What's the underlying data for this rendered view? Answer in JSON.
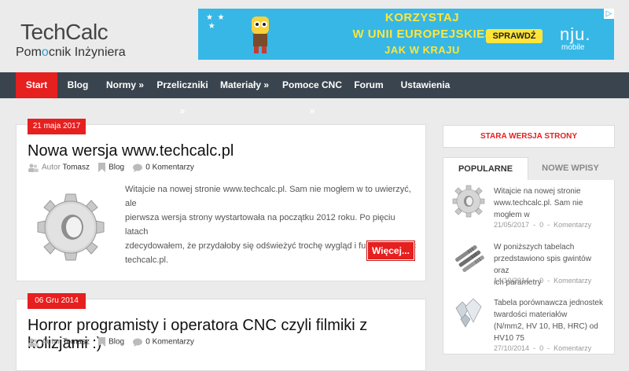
{
  "logo": {
    "title": "TechCalc",
    "subtitle_pre": "Pom",
    "subtitle_o": "o",
    "subtitle_post": "cnik Inżyniera"
  },
  "ad": {
    "line1": "KORZYSTAJ",
    "line2": "W UNII EUROPEJSKIEJ",
    "line3": "JAK W KRAJU",
    "cta": "SPRAWDŹ",
    "brand": "nju.",
    "brand_sub": "mobile",
    "adchoices": "▷"
  },
  "nav": {
    "items": [
      {
        "label": "Start"
      },
      {
        "label": "Blog"
      },
      {
        "label": "Normy »"
      },
      {
        "label": "Przeliczniki »"
      },
      {
        "label": "Materiały »"
      },
      {
        "label": "Pomoce CNC »"
      },
      {
        "label": "Forum"
      },
      {
        "label": "Ustawienia"
      }
    ]
  },
  "posts": [
    {
      "date": "21 maja 2017",
      "title": "Nowa wersja www.techcalc.pl",
      "author_label": "Autor",
      "author": "Tomasz",
      "category": "Blog",
      "comments": "0 Komentarzy",
      "excerpt_lines": [
        "Witajcie na nowej stronie www.techcalc.pl. Sam nie mogłem w to uwierzyć, ale",
        "pierwsza wersja strony wystartowała na początku 2012 roku. Po pięciu latach",
        "zdecydowałem, że przydałoby się odświeżyć trochę wygląd i funkcjonalność",
        "techcalc.pl."
      ],
      "more": "Więcej..."
    },
    {
      "date": "06 Gru 2014",
      "title": "Horror programisty i operatora CNC czyli filmiki z kolizjami :)",
      "author_label": "Autor",
      "author": "Tomasz",
      "category": "Blog",
      "comments": "0 Komentarzy"
    }
  ],
  "sidebar": {
    "old_version": "STARA WERSJA STRONY",
    "tab_popular": "POPULARNE WPISY",
    "tab_new": "NOWE WPISY",
    "items": [
      {
        "lines": [
          "Witajcie na nowej stronie",
          "www.techcalc.pl. Sam nie",
          "mogłem w"
        ],
        "date": "21/05/2017",
        "sep": "-",
        "comments": "0",
        "comments_label": "Komentarzy"
      },
      {
        "lines": [
          "W poniższych tabelach",
          "przedstawiono spis gwintów oraz",
          "ich parametry"
        ],
        "date": "14/10/2014",
        "sep": "-",
        "comments": "0",
        "comments_label": "Komentarzy"
      },
      {
        "lines": [
          "Tabela porównawcza jednostek",
          "twardości materiałów",
          "(N/mm2, HV 10, HB, HRC) od",
          "HV10 75"
        ],
        "date": "27/10/2014",
        "sep": "-",
        "comments": "0",
        "comments_label": "Komentarzy"
      }
    ]
  },
  "colors": {
    "accent": "#e61f1f",
    "navbar": "#3a444e",
    "background": "#ebebeb"
  }
}
